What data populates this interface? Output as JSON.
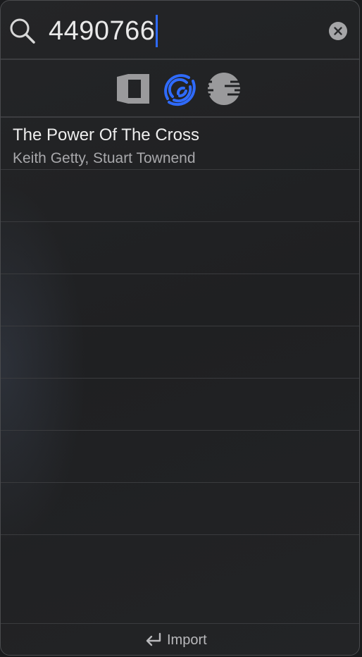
{
  "search": {
    "value": "4490766"
  },
  "sources": [
    {
      "icon": "library-book-icon",
      "active": false
    },
    {
      "icon": "songselect-icon",
      "active": true,
      "color": "#2f6bff"
    },
    {
      "icon": "lines-circle-icon",
      "active": false
    }
  ],
  "results": [
    {
      "title": "The Power Of The Cross",
      "subtitle": "Keith Getty, Stuart Townend"
    },
    {
      "title": "",
      "subtitle": ""
    },
    {
      "title": "",
      "subtitle": ""
    },
    {
      "title": "",
      "subtitle": ""
    },
    {
      "title": "",
      "subtitle": ""
    },
    {
      "title": "",
      "subtitle": ""
    },
    {
      "title": "",
      "subtitle": ""
    },
    {
      "title": "",
      "subtitle": ""
    },
    {
      "title": "",
      "subtitle": ""
    }
  ],
  "footer": {
    "import_label": "Import",
    "import_icon": "return-icon"
  },
  "colors": {
    "accent": "#2f6bff",
    "background": "#1f2022",
    "text_primary": "#eeeeee",
    "text_secondary": "#a8a8ab"
  }
}
